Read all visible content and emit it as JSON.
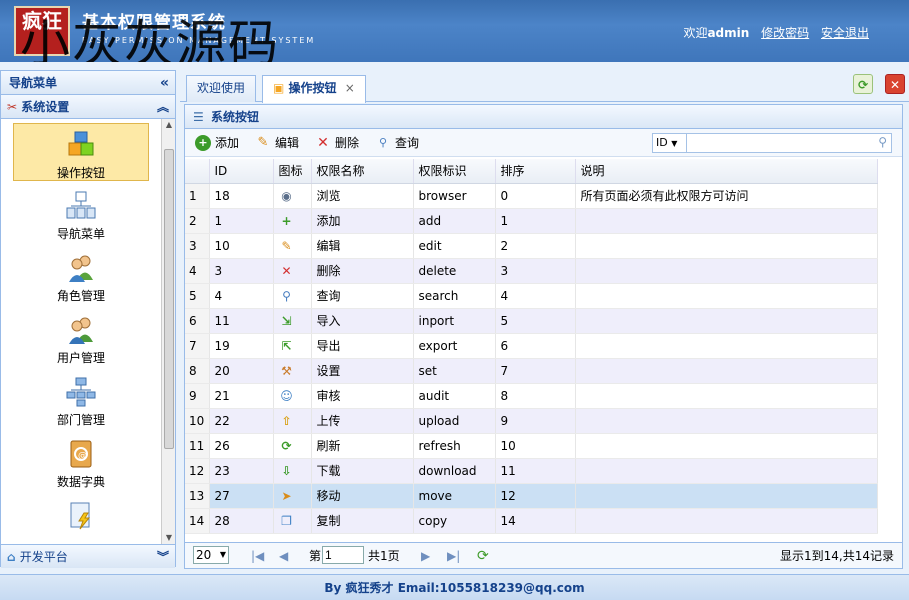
{
  "header": {
    "logo_text": "疯狂",
    "title": "基本权限管理系统",
    "subtitle": "EASY PERMISSION MANAGEMENT SYSTEM",
    "watermark": "小灰灰源码",
    "welcome_label": "欢迎",
    "username": "admin",
    "change_password": "修改密码",
    "logout": "安全退出"
  },
  "sidebar": {
    "title": "导航菜单",
    "collapse_icon": "double-chevron-left-icon",
    "section_label": "系统设置",
    "section_icon": "tools-icon",
    "items": [
      {
        "label": "操作按钮",
        "icon": "boxes-icon",
        "active": true
      },
      {
        "label": "导航菜单",
        "icon": "sitemap-icon"
      },
      {
        "label": "角色管理",
        "icon": "users-icon"
      },
      {
        "label": "用户管理",
        "icon": "user-group-icon"
      },
      {
        "label": "部门管理",
        "icon": "org-chart-icon"
      },
      {
        "label": "数据字典",
        "icon": "address-book-icon"
      },
      {
        "label": "",
        "icon": "lightning-doc-icon"
      }
    ],
    "bottom_section_label": "开发平台",
    "bottom_section_icon": "home-icon"
  },
  "tabs": [
    {
      "label": "欢迎使用",
      "active": false
    },
    {
      "label": "操作按钮",
      "active": true,
      "closable": true
    }
  ],
  "content": {
    "panel_title": "系统按钮",
    "toolbar": {
      "add": "添加",
      "edit": "编辑",
      "delete": "删除",
      "query": "查询"
    },
    "search": {
      "field": "ID",
      "placeholder": ""
    },
    "columns": [
      "ID",
      "图标",
      "权限名称",
      "权限标识",
      "排序",
      "说明"
    ],
    "rows": [
      {
        "n": "1",
        "id": "18",
        "icon": "eye-icon",
        "name": "浏览",
        "key": "browser",
        "sort": "0",
        "desc": "所有页面必须有此权限方可访问"
      },
      {
        "n": "2",
        "id": "1",
        "icon": "add-icon",
        "name": "添加",
        "key": "add",
        "sort": "1",
        "desc": ""
      },
      {
        "n": "3",
        "id": "10",
        "icon": "pencil-icon",
        "name": "编辑",
        "key": "edit",
        "sort": "2",
        "desc": ""
      },
      {
        "n": "4",
        "id": "3",
        "icon": "delete-icon",
        "name": "删除",
        "key": "delete",
        "sort": "3",
        "desc": ""
      },
      {
        "n": "5",
        "id": "4",
        "icon": "magnifier-icon",
        "name": "查询",
        "key": "search",
        "sort": "4",
        "desc": ""
      },
      {
        "n": "6",
        "id": "11",
        "icon": "import-icon",
        "name": "导入",
        "key": "inport",
        "sort": "5",
        "desc": ""
      },
      {
        "n": "7",
        "id": "19",
        "icon": "export-icon",
        "name": "导出",
        "key": "export",
        "sort": "6",
        "desc": ""
      },
      {
        "n": "8",
        "id": "20",
        "icon": "wrench-icon",
        "name": "设置",
        "key": "set",
        "sort": "7",
        "desc": ""
      },
      {
        "n": "9",
        "id": "21",
        "icon": "user-audit-icon",
        "name": "审核",
        "key": "audit",
        "sort": "8",
        "desc": ""
      },
      {
        "n": "10",
        "id": "22",
        "icon": "upload-icon",
        "name": "上传",
        "key": "upload",
        "sort": "9",
        "desc": ""
      },
      {
        "n": "11",
        "id": "26",
        "icon": "refresh-icon",
        "name": "刷新",
        "key": "refresh",
        "sort": "10",
        "desc": ""
      },
      {
        "n": "12",
        "id": "23",
        "icon": "download-icon",
        "name": "下载",
        "key": "download",
        "sort": "11",
        "desc": ""
      },
      {
        "n": "13",
        "id": "27",
        "icon": "move-icon",
        "name": "移动",
        "key": "move",
        "sort": "12",
        "desc": ""
      },
      {
        "n": "14",
        "id": "28",
        "icon": "copy-icon",
        "name": "复制",
        "key": "copy",
        "sort": "14",
        "desc": ""
      }
    ],
    "selected_row": 13,
    "pager": {
      "page_size": "20",
      "page_prefix": "第",
      "page": "1",
      "page_suffix": "共1页",
      "summary": "显示1到14,共14记录"
    }
  },
  "footer": {
    "text": "By 疯狂秀才 Email:1055818239@qq.com"
  },
  "colors": {
    "header_blue": "#3f76bb",
    "border_blue": "#99bbe8",
    "title_blue": "#15428b",
    "active_menu": "#fde9a6",
    "selected_row": "#cbe0f4",
    "alt_row": "#efeefb"
  }
}
